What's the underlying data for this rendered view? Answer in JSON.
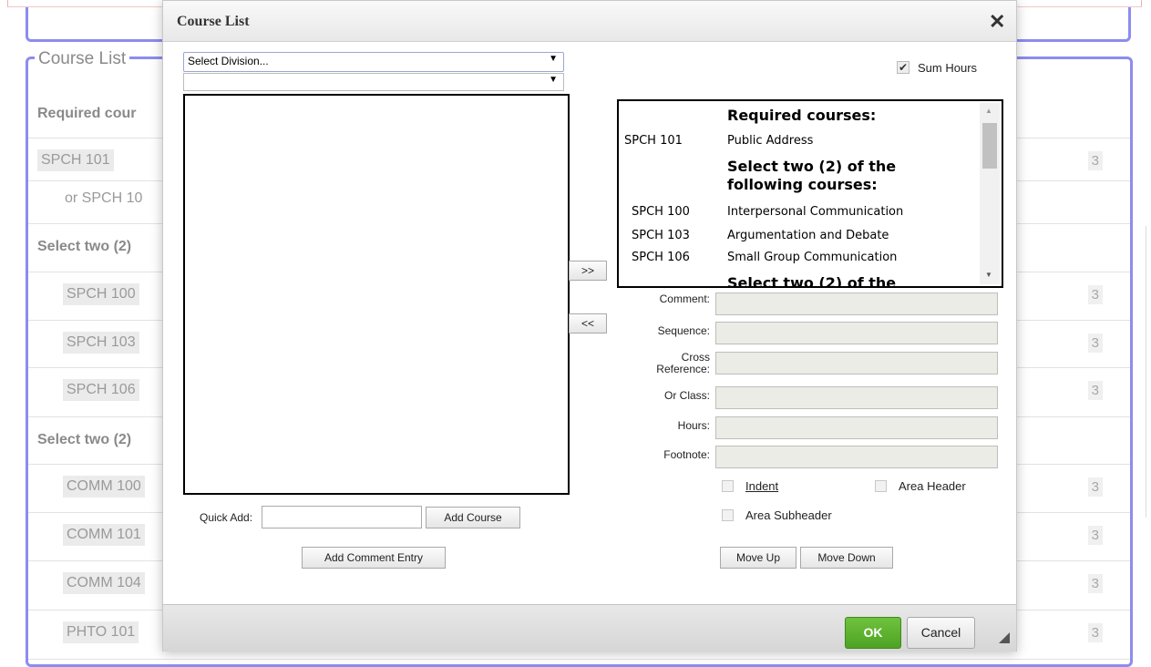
{
  "background": {
    "legend": "Course List",
    "rows": [
      {
        "text": "Required cour",
        "type": "header",
        "hours": ""
      },
      {
        "text": "SPCH 101",
        "type": "item",
        "hours": "3"
      },
      {
        "text": "or SPCH 10",
        "type": "sub",
        "hours": ""
      },
      {
        "text": "Select two (2)",
        "type": "header",
        "hours": ""
      },
      {
        "text": "SPCH 100",
        "type": "item",
        "hours": "3"
      },
      {
        "text": "SPCH 103",
        "type": "item",
        "hours": "3"
      },
      {
        "text": "SPCH 106",
        "type": "item",
        "hours": "3"
      },
      {
        "text": "Select two (2)",
        "type": "header",
        "hours": ""
      },
      {
        "text": "COMM 100",
        "type": "item",
        "hours": "3"
      },
      {
        "text": "COMM 101",
        "type": "item",
        "hours": "3"
      },
      {
        "text": "COMM 104",
        "type": "item",
        "hours": "3"
      },
      {
        "text": "PHTO 101",
        "type": "item",
        "hours": "3"
      }
    ]
  },
  "modal": {
    "title": "Course List",
    "close_icon": "close-icon",
    "division_select": "Select Division...",
    "second_select": "",
    "sum_hours_label": "Sum Hours",
    "sum_hours_checked": true,
    "move_right": ">>",
    "move_left": "<<",
    "quick_add_label": "Quick Add:",
    "quick_add_value": "",
    "add_course": "Add Course",
    "add_comment_entry": "Add Comment Entry",
    "selected_list": [
      {
        "code": "",
        "text": "Required courses:",
        "heading": true
      },
      {
        "code": "SPCH 101",
        "text": "Public Address",
        "heading": false
      },
      {
        "code": "",
        "text": "Select two (2) of the following courses:",
        "heading": true
      },
      {
        "code": "SPCH 100",
        "text": "Interpersonal Communication",
        "heading": false
      },
      {
        "code": "SPCH 103",
        "text": "Argumentation and Debate",
        "heading": false
      },
      {
        "code": "SPCH 106",
        "text": "Small Group Communication",
        "heading": false
      },
      {
        "code": "",
        "text": "Select two (2) of the",
        "heading": true
      }
    ],
    "fields": {
      "comment": "Comment:",
      "sequence": "Sequence:",
      "cross_reference_1": "Cross",
      "cross_reference_2": "Reference:",
      "or_class": "Or Class:",
      "hours": "Hours:",
      "footnote": "Footnote:"
    },
    "indent_label": "Indent",
    "area_header_label": "Area Header",
    "area_subheader_label": "Area Subheader",
    "move_up": "Move Up",
    "move_down": "Move Down",
    "ok": "OK",
    "cancel": "Cancel",
    "accent_ok": "#5bb12f"
  }
}
